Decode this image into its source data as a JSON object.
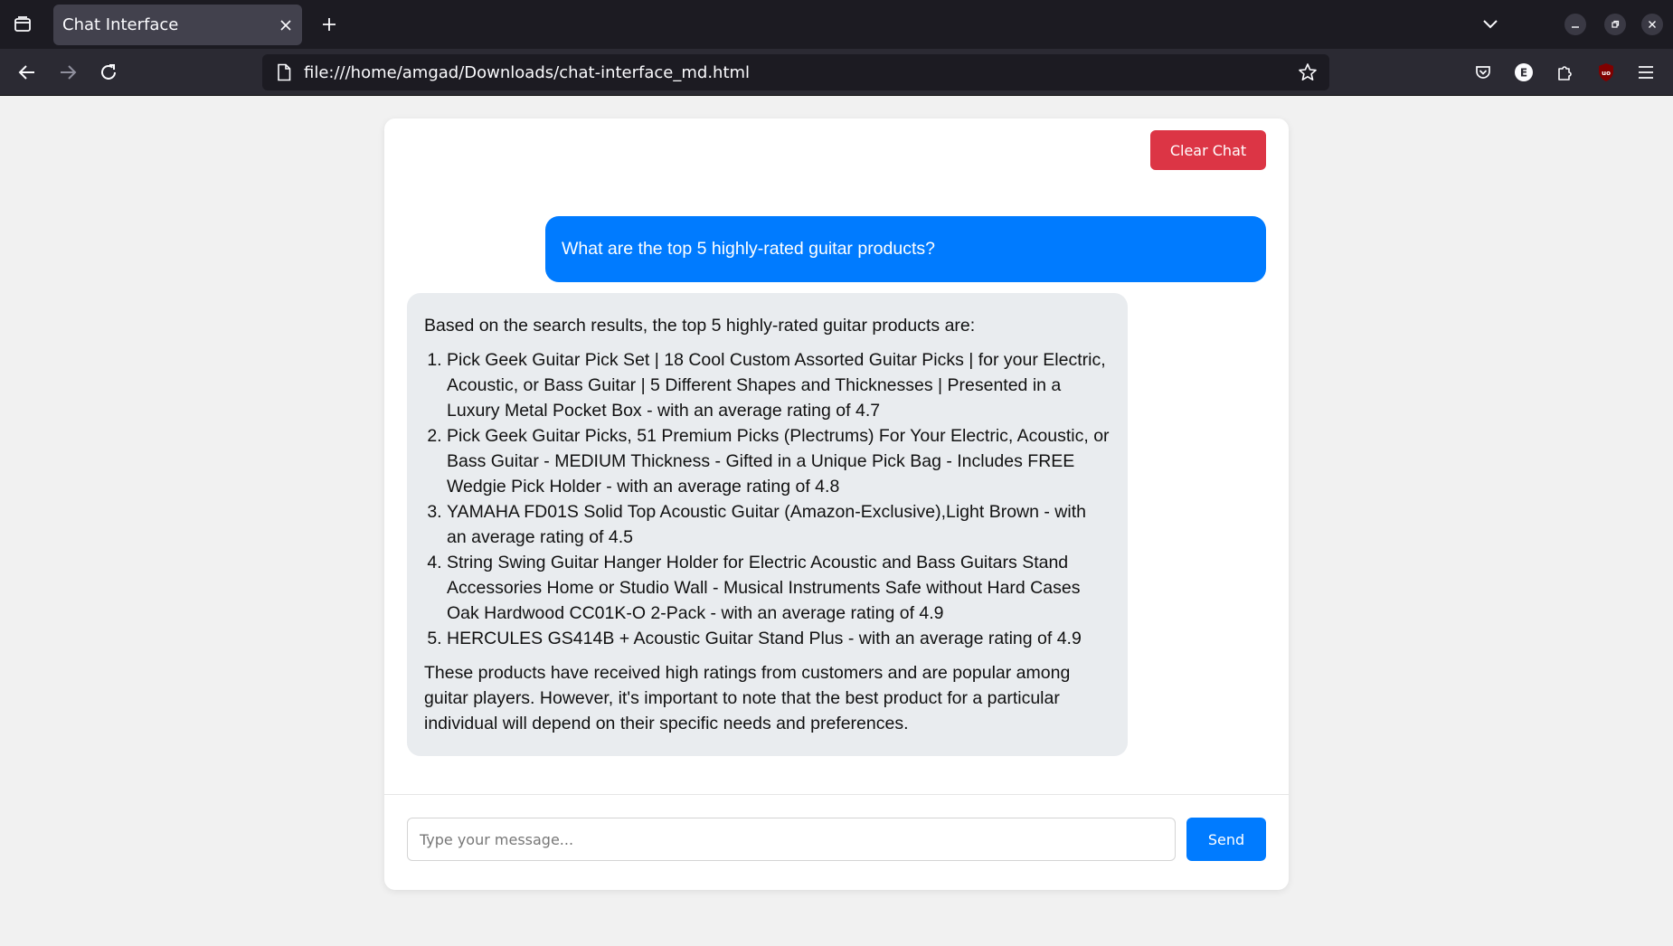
{
  "browser": {
    "tab_title": "Chat Interface",
    "url": "file:///home/amgad/Downloads/chat-interface_md.html",
    "extension_e_label": "E",
    "extension_ublock_label": "uo"
  },
  "chat": {
    "clear_label": "Clear Chat",
    "user_message": "What are the top 5 highly-rated guitar products?",
    "bot_intro": "Based on the search results, the top 5 highly-rated guitar products are:",
    "bot_items": [
      "Pick Geek Guitar Pick Set | 18 Cool Custom Assorted Guitar Picks | for your Electric, Acoustic, or Bass Guitar | 5 Different Shapes and Thicknesses | Presented in a Luxury Metal Pocket Box - with an average rating of 4.7",
      "Pick Geek Guitar Picks, 51 Premium Picks (Plectrums) For Your Electric, Acoustic, or Bass Guitar - MEDIUM Thickness - Gifted in a Unique Pick Bag - Includes FREE Wedgie Pick Holder - with an average rating of 4.8",
      "YAMAHA FD01S Solid Top Acoustic Guitar (Amazon-Exclusive),Light Brown - with an average rating of 4.5",
      "String Swing Guitar Hanger Holder for Electric Acoustic and Bass Guitars Stand Accessories Home or Studio Wall - Musical Instruments Safe without Hard Cases Oak Hardwood CC01K-O 2-Pack - with an average rating of 4.9",
      "HERCULES GS414B + Acoustic Guitar Stand Plus - with an average rating of 4.9"
    ],
    "bot_outro": "These products have received high ratings from customers and are popular among guitar players. However, it's important to note that the best product for a particular individual will depend on their specific needs and preferences.",
    "input_placeholder": "Type your message...",
    "input_value": "",
    "send_label": "Send"
  },
  "colors": {
    "user_bubble": "#007bff",
    "bot_bubble": "#e9ecef",
    "clear_button": "#dc3545",
    "send_button": "#007bff"
  }
}
